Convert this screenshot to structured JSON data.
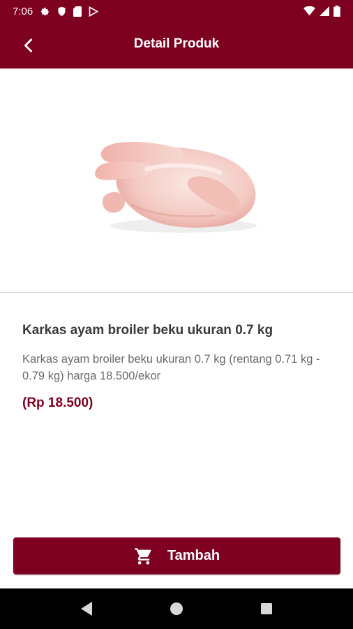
{
  "status_bar": {
    "time": "7:06",
    "icons": [
      "settings-icon",
      "shield-icon",
      "sim-card-icon",
      "play-store-icon",
      "wifi-icon",
      "signal-icon",
      "battery-icon"
    ]
  },
  "header": {
    "title": "Detail Produk",
    "back_icon": "chevron-left-icon"
  },
  "product": {
    "image_icon": "whole-chicken-image",
    "name": "Karkas ayam broiler beku ukuran 0.7 kg",
    "description": "Karkas ayam broiler beku ukuran 0.7 kg (rentang 0.71 kg - 0.79 kg) harga 18.500/ekor",
    "price": "(Rp 18.500)"
  },
  "actions": {
    "add_label": "Tambah",
    "add_icon": "cart-icon"
  },
  "nav": {
    "back": "triangle-back-icon",
    "home": "circle-home-icon",
    "recents": "square-recents-icon"
  },
  "colors": {
    "brand": "#7d0020",
    "text_dark": "#3a3a3a",
    "text_muted": "#6a6a6a"
  }
}
